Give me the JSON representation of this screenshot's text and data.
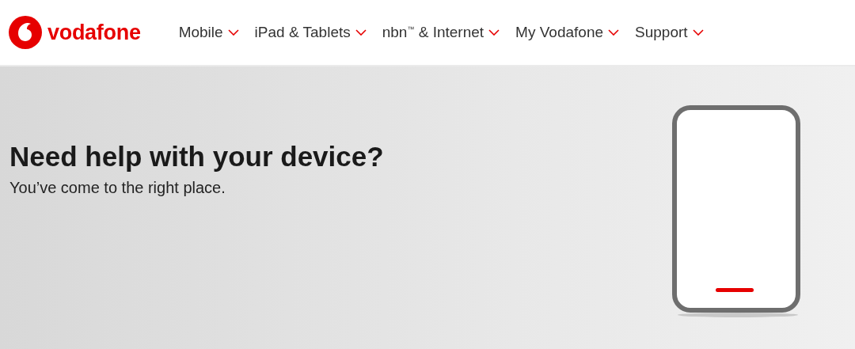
{
  "header": {
    "brand": "vodafone",
    "nav": [
      {
        "label": "Mobile"
      },
      {
        "label": "iPad & Tablets"
      },
      {
        "label": "nbn$^{™}$ & Internet"
      },
      {
        "label": "My Vodafone"
      },
      {
        "label": "Support"
      }
    ]
  },
  "hero": {
    "title": "Need help with your device?",
    "subtitle": "You’ve come to the right place."
  }
}
